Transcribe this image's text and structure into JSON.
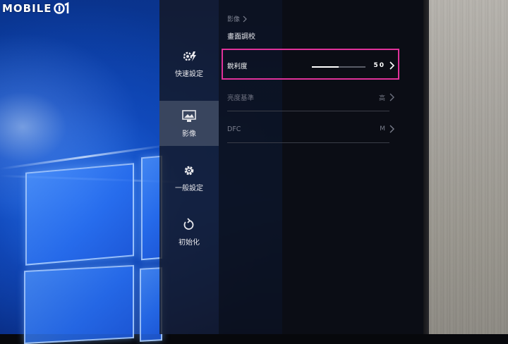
{
  "watermark": {
    "text": "MOBILE"
  },
  "sidebar": {
    "items": [
      {
        "label": "快速設定",
        "icon": "quick-settings-icon",
        "active": false
      },
      {
        "label": "影像",
        "icon": "image-icon",
        "active": true
      },
      {
        "label": "一般設定",
        "icon": "gear-icon",
        "active": false
      },
      {
        "label": "初始化",
        "icon": "reset-icon",
        "active": false
      }
    ]
  },
  "main": {
    "breadcrumb": "影像",
    "title": "畫面調校",
    "rows": [
      {
        "label": "銳利度",
        "value": "50",
        "slider": 0.5,
        "selected": true
      },
      {
        "label": "亮度基準",
        "value": "高",
        "selected": false
      },
      {
        "label": "DFC",
        "value": "M",
        "selected": false
      }
    ]
  },
  "colors": {
    "highlight": "#e0329a",
    "panel_bg": "#0c0e16",
    "text_active": "#ffffff",
    "text_dim": "#7d8190"
  }
}
